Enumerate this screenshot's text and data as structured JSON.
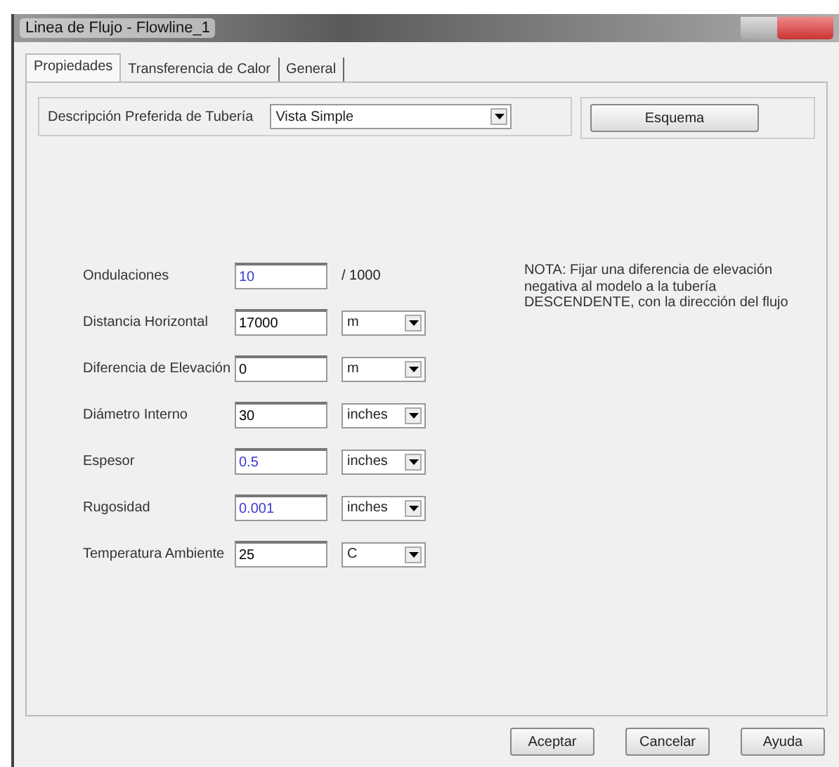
{
  "window": {
    "title": "Linea de Flujo - Flowline_1"
  },
  "tabs": [
    {
      "label": "Propiedades",
      "selected": true
    },
    {
      "label": "Transferencia de Calor",
      "selected": false
    },
    {
      "label": "General",
      "selected": false
    }
  ],
  "pipe_description": {
    "label": "Descripción Preferida de Tubería",
    "value": "Vista Simple",
    "button": "Esquema"
  },
  "fields": [
    {
      "kind": "suffix",
      "label": "Ondulaciones",
      "value": "10",
      "color": "#3a3ad0",
      "suffix": "/ 1000"
    },
    {
      "kind": "units",
      "label": "Distancia Horizontal",
      "value": "17000",
      "color": "#000000",
      "unit": "m"
    },
    {
      "kind": "units",
      "label": "Diferencia de Elevación",
      "value": "0",
      "color": "#000000",
      "unit": "m"
    },
    {
      "kind": "units",
      "label": "Diámetro Interno",
      "value": "30",
      "color": "#000000",
      "unit": "inches"
    },
    {
      "kind": "units",
      "label": "Espesor",
      "value": "0.5",
      "color": "#3a3ad0",
      "unit": "inches"
    },
    {
      "kind": "units",
      "label": "Rugosidad",
      "value": "0.001",
      "color": "#3a3ad0",
      "unit": "inches"
    },
    {
      "kind": "units",
      "label": "Temperatura Ambiente",
      "value": "25",
      "color": "#000000",
      "unit": "C"
    }
  ],
  "note": "NOTA: Fijar una diferencia de elevación negativa  al modelo a la tubería DESCENDENTE, con la dirección del flujo",
  "buttons": [
    "Aceptar",
    "Cancelar",
    "Ayuda"
  ]
}
